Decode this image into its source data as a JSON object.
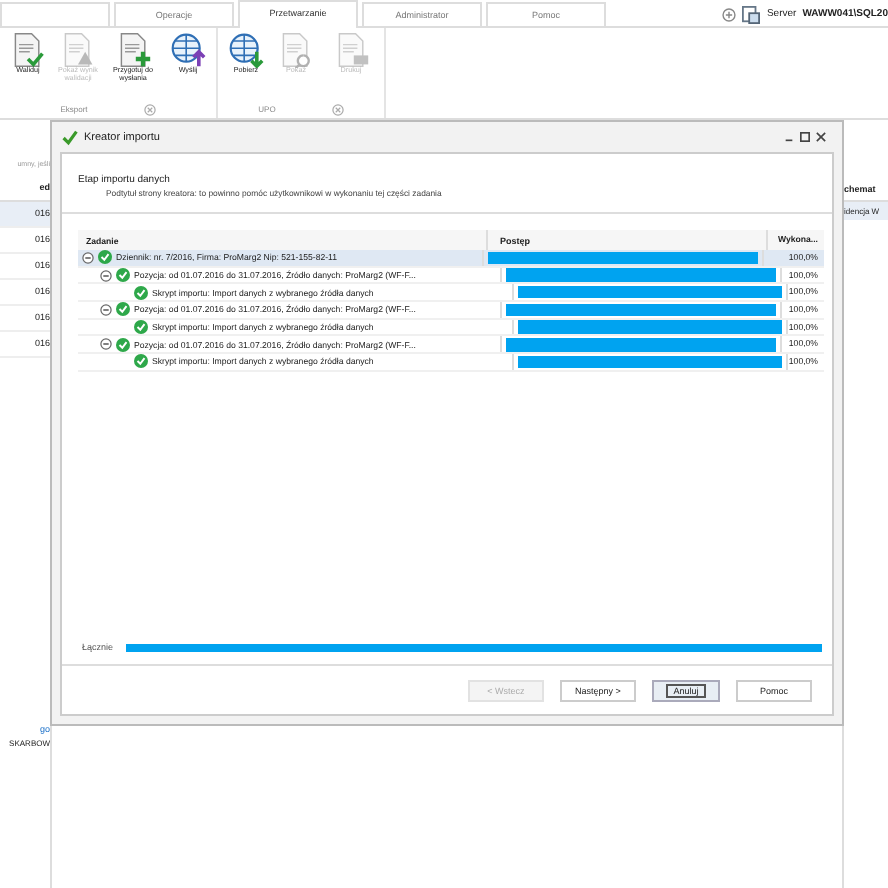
{
  "ribbon": {
    "tabs": [
      {
        "label": "Operacje",
        "selected": false
      },
      {
        "label": "Przetwarzanie",
        "selected": true
      },
      {
        "label": "Administrator",
        "selected": false
      },
      {
        "label": "Pomoc",
        "selected": false
      }
    ],
    "server_label": "Server",
    "server_name": "WAWW041\\SQL20",
    "groups": [
      {
        "label": "Eksport",
        "buttons": [
          {
            "label": "Waliduj",
            "disabled": false
          },
          {
            "label": "Pokaż wynik walidacji",
            "disabled": true
          },
          {
            "label": "Przygotuj do wysłania",
            "disabled": false
          },
          {
            "label": "Wyślij",
            "disabled": false
          }
        ]
      },
      {
        "label": "UPO",
        "buttons": [
          {
            "label": "Pobierz",
            "disabled": false
          },
          {
            "label": "Pokaż",
            "disabled": true
          },
          {
            "label": "Drukuj",
            "disabled": true
          }
        ]
      }
    ]
  },
  "background": {
    "hint": "umny, jeśli",
    "grid_header": "ed",
    "grid_rows": [
      "016",
      "016",
      "016",
      "016",
      "016",
      "016"
    ],
    "right_header": "chemat",
    "right_row": "idencja W",
    "link": "go",
    "value": "SKARBOW"
  },
  "dialog": {
    "title": "Kreator importu",
    "step_title": "Etap importu danych",
    "step_subtitle": "Podtytuł strony kreatora: to powinno pomóc użytkownikowi w wykonaniu tej części zadania",
    "columns": [
      "Zadanie",
      "Postęp",
      "Wykona..."
    ],
    "tasks": [
      {
        "label": "Dziennik: nr. 7/2016, Firma: ProMarg2 Nip: 521-155-82-11",
        "level": 1,
        "reading": "100,0%",
        "expanded": true,
        "selected": true,
        "children": [
          {
            "label": "Pozycja: od 01.07.2016 do 31.07.2016, Źródło danych: ProMarg2 (WF-F...",
            "level": 1,
            "reading": "100,0%",
            "expanded": true,
            "selected": false,
            "children": [
              {
                "label": "Skrypt importu: Import danych z wybranego źródła danych",
                "level": 1,
                "reading": "100,0%",
                "selected": false
              }
            ]
          },
          {
            "label": "Pozycja: od 01.07.2016 do 31.07.2016, Źródło danych: ProMarg2 (WF-F...",
            "level": 1,
            "reading": "100,0%",
            "expanded": true,
            "selected": false,
            "children": [
              {
                "label": "Skrypt importu: Import danych z wybranego źródła danych",
                "level": 1,
                "reading": "100,0%",
                "selected": false
              }
            ]
          },
          {
            "label": "Pozycja: od 01.07.2016 do 31.07.2016, Źródło danych: ProMarg2 (WF-F...",
            "level": 1,
            "reading": "100,0%",
            "expanded": true,
            "selected": false,
            "children": [
              {
                "label": "Skrypt importu: Import danych z wybranego źródła danych",
                "level": 1,
                "reading": "100,0%",
                "selected": false
              }
            ]
          }
        ]
      }
    ],
    "total": {
      "label": "Łącznie",
      "level": 1
    },
    "buttons": [
      {
        "label": "< Wstecz",
        "disabled": true,
        "focused": false
      },
      {
        "label": "Następny >",
        "disabled": false,
        "focused": false
      },
      {
        "label": "Anuluj",
        "disabled": false,
        "focused": true
      },
      {
        "label": "Pomoc",
        "disabled": false,
        "focused": false
      }
    ]
  }
}
